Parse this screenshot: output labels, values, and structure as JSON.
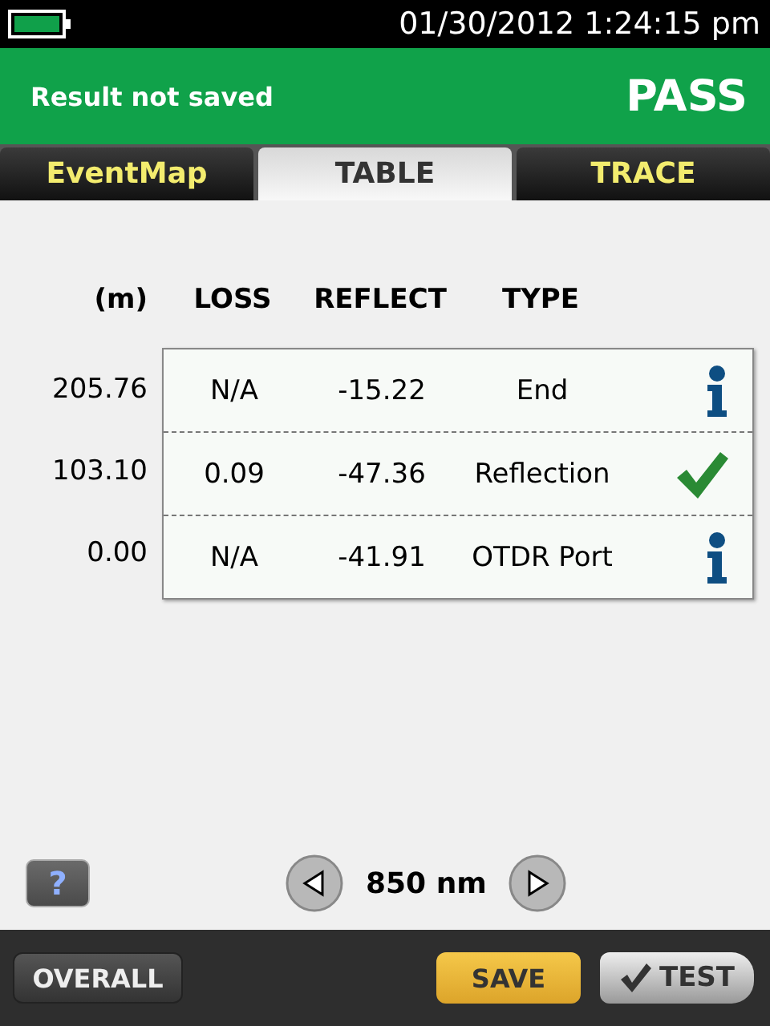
{
  "status_bar": {
    "datetime": "01/30/2012 1:24:15 pm"
  },
  "header": {
    "message": "Result not saved",
    "result": "PASS"
  },
  "tabs": [
    {
      "label": "EventMap",
      "selected": false
    },
    {
      "label": "TABLE",
      "selected": true
    },
    {
      "label": "TRACE",
      "selected": false
    }
  ],
  "table": {
    "columns": [
      "(m)",
      "LOSS",
      "REFLECT",
      "TYPE"
    ],
    "rows": [
      {
        "distance": "205.76",
        "loss": "N/A",
        "reflect": "-15.22",
        "type": "End",
        "kind": "info"
      },
      {
        "distance": "103.10",
        "loss": "0.09",
        "reflect": "-47.36",
        "type": "Reflection",
        "kind": "pass"
      },
      {
        "distance": "0.00",
        "loss": "N/A",
        "reflect": "-41.91",
        "type": "OTDR Port",
        "kind": "info"
      }
    ]
  },
  "help_button": "?",
  "wavelength": "850 nm",
  "buttons": {
    "overall": "OVERALL",
    "save": "SAVE",
    "test": "TEST"
  }
}
